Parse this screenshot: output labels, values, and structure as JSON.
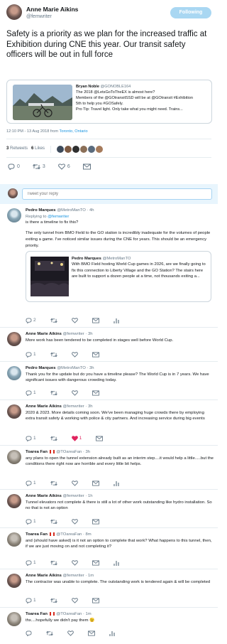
{
  "main": {
    "author": "Anne Marie Aikins",
    "handle": "@femwriter",
    "follow_label": "Following",
    "text": "Safety is a priority as we plan for the increased traffic at Exhibition during CNE this year. Our transit safety officers will be out in full force",
    "quote": {
      "author": "Bryan Noble",
      "handle": "@GONOBLE164",
      "lines": [
        "The 2018 @LetsGoToTheEX is almost here?",
        "Members of the @GOtransitSSD will be at @GOtransit #Exhibition",
        "5th to help you #GOSafely.",
        "Pro Tip: Travel light. Only take what you might need. Trains..."
      ]
    },
    "timestamp": "12:10 PM - 13 Aug 2018 from",
    "location": "Toronto, Ontario",
    "retweets": "3",
    "retweets_label": "Retweets",
    "likes": "6",
    "likes_label": "Likes",
    "actions": {
      "reply": "0",
      "retweet": "3",
      "like": "6",
      "dm": ""
    }
  },
  "reply_box": {
    "placeholder": "Tweet your reply"
  },
  "replies": [
    {
      "name": "Pedro Marques",
      "handle": "@MetroManTO",
      "time": "· 4h",
      "replying_prefix": "Replying to",
      "replying_to": "@femwriter",
      "body": "is there a timeline to fix this?",
      "body2": "The only tunnel from BMO Field to the GO station is incredibly inadequate for the volumes of people exiting a game. I've noticed similar issues during the CNE for years. This should be an emergency priority.",
      "embed": {
        "author": "Pedro Marques",
        "handle": "@MetroManTO",
        "text": "With BMO Field hosting World Cup games in 2026, are we finally going to fix this connection to Liberty Village and the GO Station? The stairs here are built to support a dozen people at a time, not thousands exiting a..."
      },
      "counts": {
        "reply": "2",
        "retweet": "",
        "like": ""
      }
    },
    {
      "name": "Anne Marie Aikins",
      "handle": "@femwriter",
      "time": "· 3h",
      "body": "More work has been tendered to be completed in stages well before World Cup.",
      "counts": {
        "reply": "1",
        "retweet": "",
        "like": ""
      }
    },
    {
      "name": "Pedro Marques",
      "handle": "@MetroManTO",
      "time": "· 3h",
      "body": "Thank you for the update but do you have a timeline please? The World Cup is in 7 years. We have significant issues with dangerous crowding today.",
      "counts": {
        "reply": "1",
        "retweet": "",
        "like": ""
      }
    },
    {
      "name": "Anne Marie Aikins",
      "handle": "@femwriter",
      "time": "· 3h",
      "body": "2020 & 2023. More details coming soon. We've been managing huge crowds there by employing extra transit safety & working with police & city partners. And increasing service during big events",
      "counts": {
        "reply": "1",
        "retweet": "",
        "like": "1"
      }
    },
    {
      "name": "Toarea Fan",
      "handle": "@TOareaFan",
      "time": "· 3h",
      "body": "any plans to open the tunnel extension already built as an interim step....it would help a little.....but the conditions there right now are horrible and every little bit helps.",
      "counts": {
        "reply": "1",
        "retweet": "",
        "like": ""
      }
    },
    {
      "name": "Anne Marie Aikins",
      "handle": "@femwriter",
      "time": "· 1h",
      "body": "Tunnel elevators not complete & there is still a lot of other work outstanding like hydro installation. So no that is not an option",
      "counts": {
        "reply": "1",
        "retweet": "",
        "like": ""
      }
    },
    {
      "name": "Toarea Fan",
      "handle": "@TOareaFan",
      "time": "· 8m",
      "body": "and (should have asked) is it not an option to complete that work?  What happens to this tunnel, then, if we are just moving on and not completing it?",
      "counts": {
        "reply": "1",
        "retweet": "",
        "like": ""
      }
    },
    {
      "name": "Anne Marie Aikins",
      "handle": "@femwriter",
      "time": "· 1m",
      "body": "The contractor was unable to complete. The outstanding work is tendered again & will be completed",
      "counts": {
        "reply": "1",
        "retweet": "",
        "like": ""
      }
    },
    {
      "name": "Toarea Fan",
      "handle": "@TOareaFan",
      "time": "· 1m",
      "body": "thx....hopefully we didn't pay them 😉",
      "counts": {
        "reply": "",
        "retweet": "",
        "like": ""
      }
    }
  ]
}
